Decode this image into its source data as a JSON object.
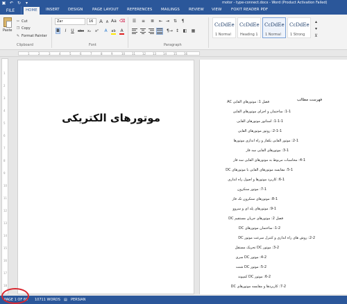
{
  "titlebar": {
    "title": "motor - type-connect.docx - Word (Product Activation Failed)",
    "quick_access": [
      {
        "name": "save-icon",
        "glyph": "▣"
      },
      {
        "name": "undo-icon",
        "glyph": "↶"
      },
      {
        "name": "redo-icon",
        "glyph": "↻"
      },
      {
        "name": "customize-icon",
        "glyph": "▾"
      }
    ]
  },
  "tabs": {
    "file": "FILE",
    "items": [
      "HOME",
      "INSERT",
      "DESIGN",
      "PAGE LAYOUT",
      "REFERENCES",
      "MAILINGS",
      "REVIEW",
      "VIEW",
      "FOXIT READER PDF"
    ],
    "active": "HOME"
  },
  "ribbon": {
    "clipboard": {
      "paste": "Paste",
      "cut": "Cut",
      "copy": "Copy",
      "format_painter": "Format Painter",
      "label": "Clipboard"
    },
    "font": {
      "name": "Zar",
      "size": "16",
      "label": "Font",
      "buttons": [
        "B",
        "I",
        "U",
        "abc",
        "x₂",
        "x²",
        "A",
        "ab",
        "A"
      ]
    },
    "paragraph": {
      "label": "Paragraph"
    },
    "styles": [
      {
        "sample": "CcDdEe",
        "name": "1 Normal"
      },
      {
        "sample": "CcDdEe",
        "name": "Heading 1"
      },
      {
        "sample": "CcDdEe",
        "name": "1 Normal"
      },
      {
        "sample": "CcDdEe",
        "name": "1 Strong"
      }
    ]
  },
  "ruler": {
    "ticks": [
      "1",
      "2",
      "3",
      "4",
      "5",
      "6",
      "7",
      "8",
      "9",
      "10",
      "11",
      "12",
      "13",
      "14",
      "15",
      "16"
    ]
  },
  "vruler": {
    "ticks": [
      "1",
      "2",
      "3",
      "4",
      "5",
      "6",
      "7",
      "8",
      "9",
      "10",
      "11",
      "12",
      "13",
      "14",
      "15",
      "16",
      "17",
      "18",
      "19"
    ]
  },
  "document": {
    "title": "موتورهای الکتریکی",
    "toc_heading": "فهرست مطالب",
    "toc": [
      "فصل 1: موتورهای القایی AC",
      "1-1: ساختمان و اجزای موتورهای القایی",
      "1-1-1: استاتور موتورهای القایی",
      "2-1-1: روتور موتورهای القایی",
      "2-1: موتور القایی یکفاز و راه اندازی موتورها",
      "3-1: موتورهای القایی سه فاز",
      "4-1: محاسبات مربوط به موتورهای القایی سه فاز",
      "5-1: مقایسه موتورهای القایی با موتورهای DC",
      "6-1: کاربرد موتورها و اصول راه اندازی",
      "7-1: موتور سنکرون",
      "8-1: موتورهای سنکرون تک فاز",
      "9-1: موتورهای پله ای و سروو",
      "فصل 2: موتورهای جریان مستقیم DC",
      "1-2: ساختمان موتورهای DC",
      "2-2: روش های راه اندازی و کنترل سرعت موتور DC",
      "3-2: موتور DC تحریک مستقل",
      "4-2: موتور DC سری",
      "5-2: موتور DC شنت",
      "6-2: موتور DC کمپوند",
      "7-2: کاربردها و مقایسه موتورهای DC"
    ]
  },
  "statusbar": {
    "page": "PAGE 1 OF 60",
    "words": "10711 WORDS",
    "language": "PERSIAN"
  },
  "colors": {
    "accent": "#2b579a",
    "highlight_circle": "#d9262f"
  }
}
